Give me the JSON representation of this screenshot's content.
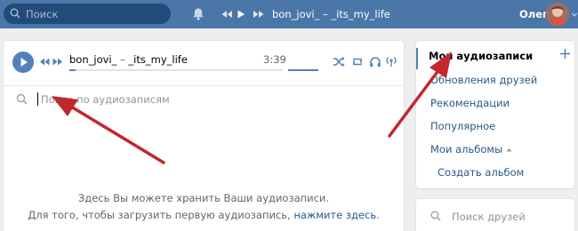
{
  "header": {
    "search_placeholder": "Поиск",
    "now_playing": "bon_jovi_ – _its_my_life",
    "user_name": "Олег"
  },
  "player": {
    "artist": "bon_jovi_",
    "separator": " – ",
    "title": "_its_my_life",
    "duration": "3:39",
    "progress": 0.03
  },
  "audio_search": {
    "placeholder": "Поиск по аудиозаписям"
  },
  "empty_state": {
    "line1": "Здесь Вы можете хранить Ваши аудиозаписи.",
    "line2": "Для того, чтобы загрузить первую аудиозапись,",
    "link": "нажмите здесь"
  },
  "sidebar": {
    "items": [
      {
        "label": "Мои аудиозаписи",
        "active": true
      },
      {
        "label": "Обновления друзей"
      },
      {
        "label": "Рекомендации"
      },
      {
        "label": "Популярное"
      },
      {
        "label": "Мои альбомы"
      },
      {
        "label": "Создать альбом"
      }
    ]
  },
  "friends_search": {
    "placeholder": "Поиск друзей"
  },
  "icons": {
    "header": [
      "search-icon",
      "bell-icon",
      "prev-icon",
      "play-icon",
      "next-icon"
    ],
    "player": [
      "play-icon",
      "prev-icon",
      "next-icon",
      "shuffle-icon",
      "repeat-icon",
      "headphones-icon",
      "broadcast-icon"
    ]
  },
  "colors": {
    "header_bg": "#4a76a8",
    "accent": "#5181b8",
    "link": "#2a5885",
    "arrow": "#c0282d"
  }
}
